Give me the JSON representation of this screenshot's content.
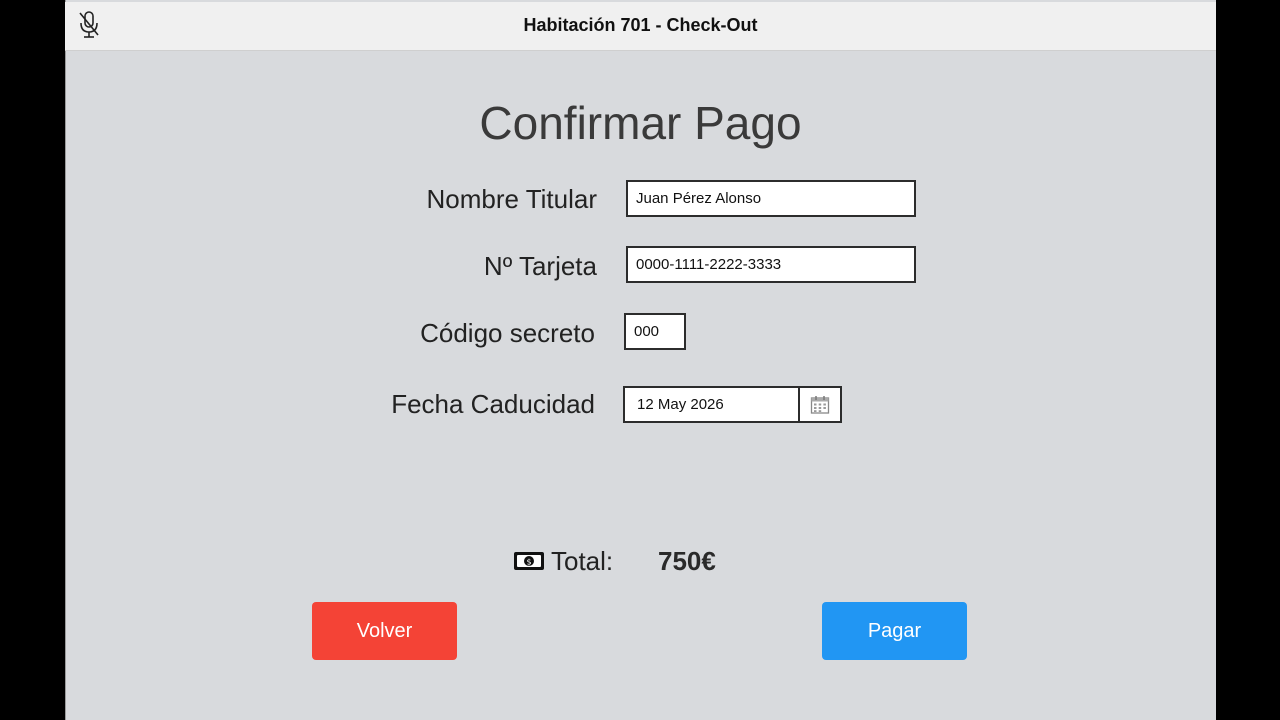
{
  "window": {
    "title": "Habitación 701 - Check-Out",
    "mic_icon": "mic-off-icon"
  },
  "page": {
    "title": "Confirmar Pago"
  },
  "form": {
    "holder_label": "Nombre Titular",
    "holder_value": "Juan Pérez Alonso",
    "card_label": "Nº Tarjeta",
    "card_value": "0000-1111-2222-3333",
    "cvv_label": "Código secreto",
    "cvv_value": "000",
    "expiry_label": "Fecha Caducidad",
    "expiry_value": "12 May 2026",
    "calendar_icon": "calendar-icon"
  },
  "total": {
    "icon": "money-icon",
    "label": "Total:",
    "value": "750€"
  },
  "buttons": {
    "back_label": "Volver",
    "pay_label": "Pagar"
  },
  "colors": {
    "back_button": "#f44336",
    "pay_button": "#2196f3",
    "background": "#d8dadd"
  }
}
